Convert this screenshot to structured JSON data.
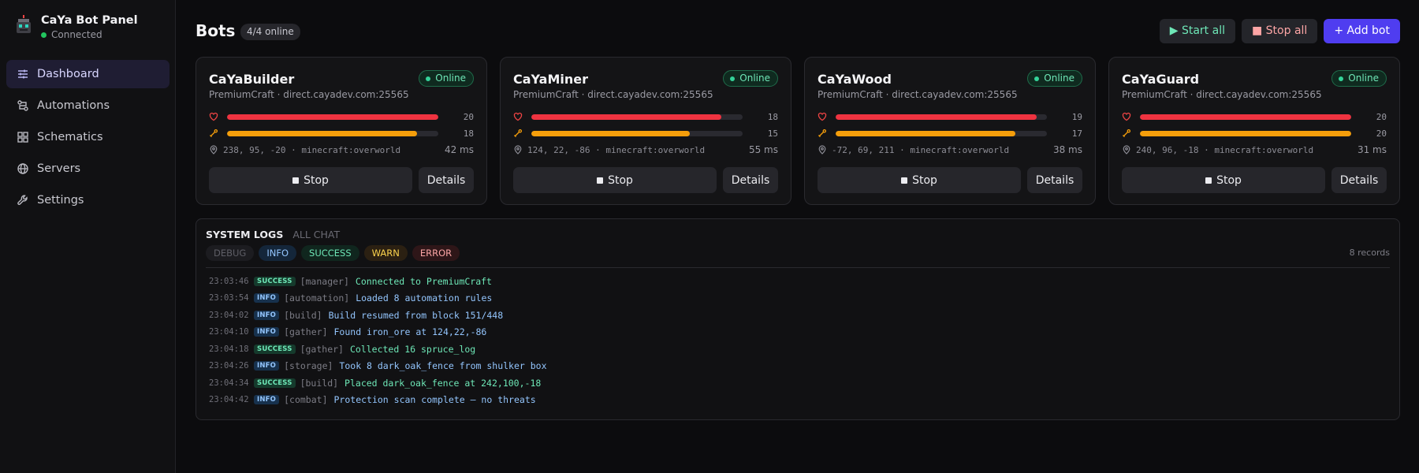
{
  "brand": {
    "title": "CaYa Bot Panel",
    "status": "Connected"
  },
  "sidebar": {
    "items": [
      {
        "label": "Dashboard",
        "icon": "sliders-icon",
        "active": true
      },
      {
        "label": "Automations",
        "icon": "workflow-icon",
        "active": false
      },
      {
        "label": "Schematics",
        "icon": "grid-icon",
        "active": false
      },
      {
        "label": "Servers",
        "icon": "globe-icon",
        "active": false
      },
      {
        "label": "Settings",
        "icon": "wrench-icon",
        "active": false
      }
    ]
  },
  "header": {
    "title": "Bots",
    "online_badge": "4/4 online",
    "start_all": "▶ Start all",
    "stop_all": "■ Stop all",
    "add_bot": "+ Add bot"
  },
  "bots": [
    {
      "name": "CaYaBuilder",
      "server": "PremiumCraft · direct.cayadev.com:25565",
      "status": "Online",
      "health": 20,
      "health_max": 20,
      "food": 18,
      "food_max": 20,
      "location": "238, 95, -20 · minecraft:overworld",
      "ping": "42 ms",
      "stop_label": "Stop",
      "details_label": "Details"
    },
    {
      "name": "CaYaMiner",
      "server": "PremiumCraft · direct.cayadev.com:25565",
      "status": "Online",
      "health": 18,
      "health_max": 20,
      "food": 15,
      "food_max": 20,
      "location": "124, 22, -86 · minecraft:overworld",
      "ping": "55 ms",
      "stop_label": "Stop",
      "details_label": "Details"
    },
    {
      "name": "CaYaWood",
      "server": "PremiumCraft · direct.cayadev.com:25565",
      "status": "Online",
      "health": 19,
      "health_max": 20,
      "food": 17,
      "food_max": 20,
      "location": "-72, 69, 211 · minecraft:overworld",
      "ping": "38 ms",
      "stop_label": "Stop",
      "details_label": "Details"
    },
    {
      "name": "CaYaGuard",
      "server": "PremiumCraft · direct.cayadev.com:25565",
      "status": "Online",
      "health": 20,
      "health_max": 20,
      "food": 20,
      "food_max": 20,
      "location": "240, 96, -18 · minecraft:overworld",
      "ping": "31 ms",
      "stop_label": "Stop",
      "details_label": "Details"
    }
  ],
  "logs": {
    "tabs": [
      {
        "label": "SYSTEM LOGS",
        "active": true
      },
      {
        "label": "ALL CHAT",
        "active": false
      }
    ],
    "filters": [
      "DEBUG",
      "INFO",
      "SUCCESS",
      "WARN",
      "ERROR"
    ],
    "records": "8 records",
    "entries": [
      {
        "time": "23:03:46",
        "level": "SUCCESS",
        "source": "[manager]",
        "message": "Connected to PremiumCraft"
      },
      {
        "time": "23:03:54",
        "level": "INFO",
        "source": "[automation]",
        "message": "Loaded 8 automation rules"
      },
      {
        "time": "23:04:02",
        "level": "INFO",
        "source": "[build]",
        "message": "Build resumed from block 151/448"
      },
      {
        "time": "23:04:10",
        "level": "INFO",
        "source": "[gather]",
        "message": "Found iron_ore at 124,22,-86"
      },
      {
        "time": "23:04:18",
        "level": "SUCCESS",
        "source": "[gather]",
        "message": "Collected 16 spruce_log"
      },
      {
        "time": "23:04:26",
        "level": "INFO",
        "source": "[storage]",
        "message": "Took 8 dark_oak_fence from shulker box"
      },
      {
        "time": "23:04:34",
        "level": "SUCCESS",
        "source": "[build]",
        "message": "Placed dark_oak_fence at 242,100,-18"
      },
      {
        "time": "23:04:42",
        "level": "INFO",
        "source": "[combat]",
        "message": "Protection scan complete — no threats"
      }
    ]
  }
}
